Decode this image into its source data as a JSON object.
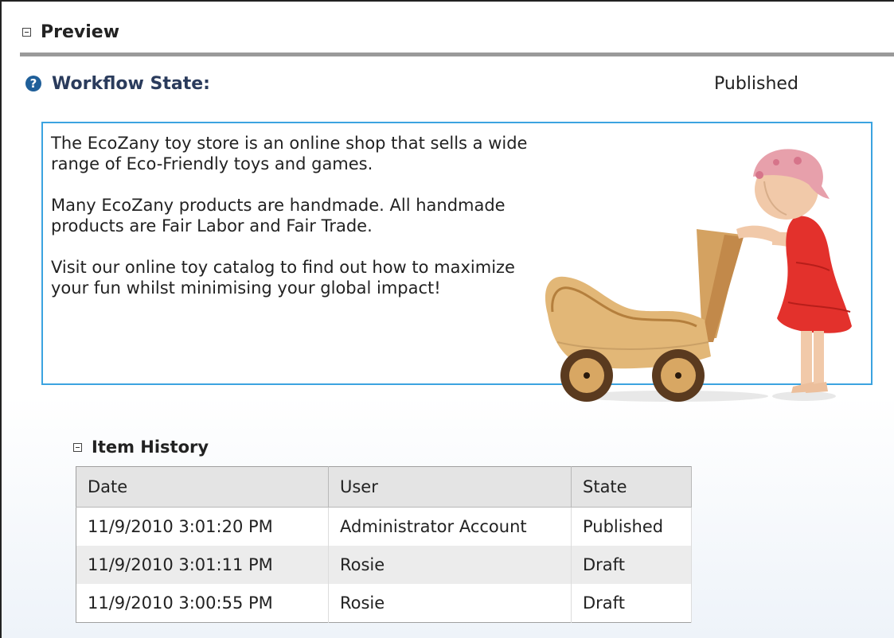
{
  "preview": {
    "title": "Preview"
  },
  "workflow": {
    "label": "Workflow State:",
    "value": "Published"
  },
  "content": {
    "paragraphs": [
      "The EcoZany toy store is an online shop that sells a wide range of Eco-Friendly toys and games.",
      "Many EcoZany products are handmade. All handmade products are Fair Labor and Fair Trade.",
      "Visit our online toy catalog to find out how to maximize your fun whilst minimising your global impact!"
    ]
  },
  "history": {
    "title": "Item History",
    "columns": [
      "Date",
      "User",
      "State"
    ],
    "rows": [
      [
        "11/9/2010 3:01:20 PM",
        "Administrator Account",
        "Published"
      ],
      [
        "11/9/2010 3:01:11 PM",
        "Rosie",
        "Draft"
      ],
      [
        "11/9/2010 3:00:55 PM",
        "Rosie",
        "Draft"
      ]
    ]
  },
  "colors": {
    "accent_border": "#3ba3e0",
    "help_icon": "#1f5f99",
    "divider": "#9a9a9a"
  },
  "icons": {
    "collapse": "collapse-icon",
    "help": "help-icon"
  }
}
